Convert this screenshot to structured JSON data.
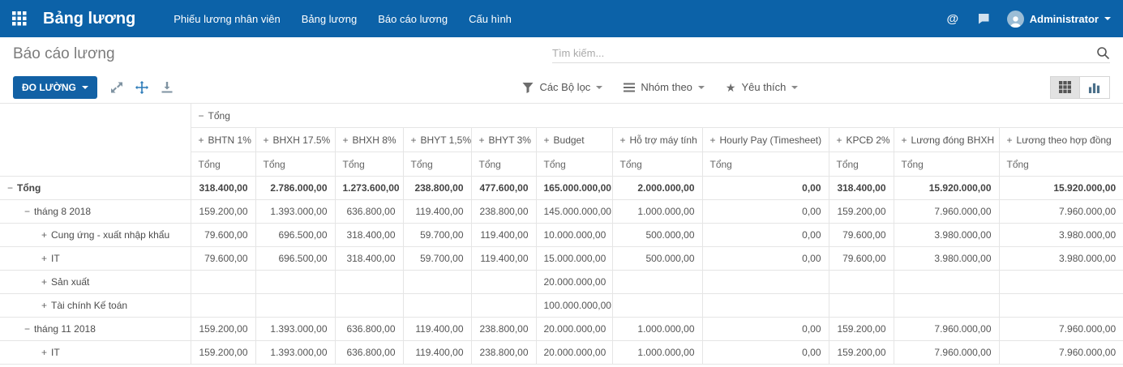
{
  "colors": {
    "topbar": "#0c62a8",
    "measures_button": "#1261a5",
    "expand_all_icon": "#2a7ab8",
    "icon_gray": "#7f93a2"
  },
  "topbar": {
    "brand": "Bảng lương",
    "menu": [
      "Phiếu lương nhân viên",
      "Bảng lương",
      "Báo cáo lương",
      "Cấu hình"
    ],
    "mentions_icon": "@",
    "user": {
      "name": "Administrator"
    }
  },
  "page": {
    "title": "Báo cáo lương",
    "search": {
      "placeholder": "Tìm kiếm..."
    }
  },
  "controls": {
    "measures": "ĐO LƯỜNG",
    "filters": "Các Bộ lọc",
    "group_by": "Nhóm theo",
    "favorites": "Yêu thích",
    "icons": [
      "flip-axis-icon",
      "expand-all-icon",
      "download-icon"
    ],
    "view_switcher": [
      "pivot-view",
      "graph-view"
    ],
    "active_view": "pivot-view"
  },
  "pivot": {
    "column_group": {
      "expander": "−",
      "label": "Tổng"
    },
    "subtotal_label": "Tổng",
    "measures": [
      "BHTN 1%",
      "BHXH 17.5%",
      "BHXH 8%",
      "BHYT 1,5%",
      "BHYT 3%",
      "Budget",
      "Hỗ trợ máy tính",
      "Hourly Pay (Timesheet)",
      "KPCĐ 2%",
      "Lương đóng BHXH",
      "Lương theo hợp đồng"
    ],
    "rows": [
      {
        "label": "Tổng",
        "level": 0,
        "expander": "−",
        "bold": true,
        "values": [
          "318.400,00",
          "2.786.000,00",
          "1.273.600,00",
          "238.800,00",
          "477.600,00",
          "165.000.000,00",
          "2.000.000,00",
          "0,00",
          "318.400,00",
          "15.920.000,00",
          "15.920.000,00"
        ]
      },
      {
        "label": "tháng 8 2018",
        "level": 1,
        "expander": "−",
        "bold": false,
        "values": [
          "159.200,00",
          "1.393.000,00",
          "636.800,00",
          "119.400,00",
          "238.800,00",
          "145.000.000,00",
          "1.000.000,00",
          "0,00",
          "159.200,00",
          "7.960.000,00",
          "7.960.000,00"
        ]
      },
      {
        "label": "Cung ứng - xuất nhập khẩu",
        "level": 2,
        "expander": "+",
        "bold": false,
        "values": [
          "79.600,00",
          "696.500,00",
          "318.400,00",
          "59.700,00",
          "119.400,00",
          "10.000.000,00",
          "500.000,00",
          "0,00",
          "79.600,00",
          "3.980.000,00",
          "3.980.000,00"
        ]
      },
      {
        "label": "IT",
        "level": 2,
        "expander": "+",
        "bold": false,
        "values": [
          "79.600,00",
          "696.500,00",
          "318.400,00",
          "59.700,00",
          "119.400,00",
          "15.000.000,00",
          "500.000,00",
          "0,00",
          "79.600,00",
          "3.980.000,00",
          "3.980.000,00"
        ]
      },
      {
        "label": "Sản xuất",
        "level": 2,
        "expander": "+",
        "bold": false,
        "values": [
          "",
          "",
          "",
          "",
          "",
          "20.000.000,00",
          "",
          "",
          "",
          "",
          ""
        ]
      },
      {
        "label": "Tài chính Kế toán",
        "level": 2,
        "expander": "+",
        "bold": false,
        "values": [
          "",
          "",
          "",
          "",
          "",
          "100.000.000,00",
          "",
          "",
          "",
          "",
          ""
        ]
      },
      {
        "label": "tháng 11 2018",
        "level": 1,
        "expander": "−",
        "bold": false,
        "values": [
          "159.200,00",
          "1.393.000,00",
          "636.800,00",
          "119.400,00",
          "238.800,00",
          "20.000.000,00",
          "1.000.000,00",
          "0,00",
          "159.200,00",
          "7.960.000,00",
          "7.960.000,00"
        ]
      },
      {
        "label": "IT",
        "level": 2,
        "expander": "+",
        "bold": false,
        "values": [
          "159.200,00",
          "1.393.000,00",
          "636.800,00",
          "119.400,00",
          "238.800,00",
          "20.000.000,00",
          "1.000.000,00",
          "0,00",
          "159.200,00",
          "7.960.000,00",
          "7.960.000,00"
        ]
      }
    ]
  }
}
